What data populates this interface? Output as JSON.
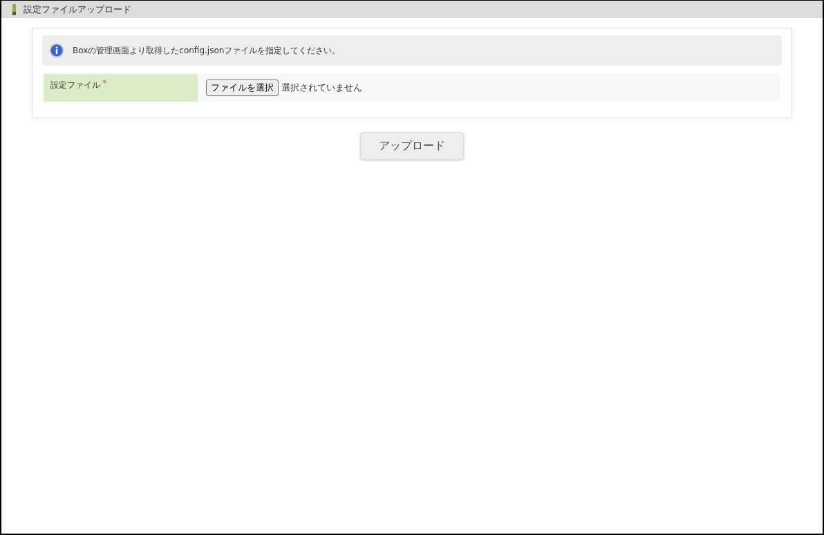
{
  "header": {
    "title": "設定ファイルアップロード"
  },
  "info": {
    "message": "Boxの管理画面より取得したconfig.jsonファイルを指定してください。"
  },
  "fields": [
    {
      "label": "設定ファイル",
      "required_mark": "*",
      "kind": "file",
      "button": "ファイルを選択",
      "status": "選択されていません"
    }
  ],
  "buttons": [
    "アップロード"
  ]
}
